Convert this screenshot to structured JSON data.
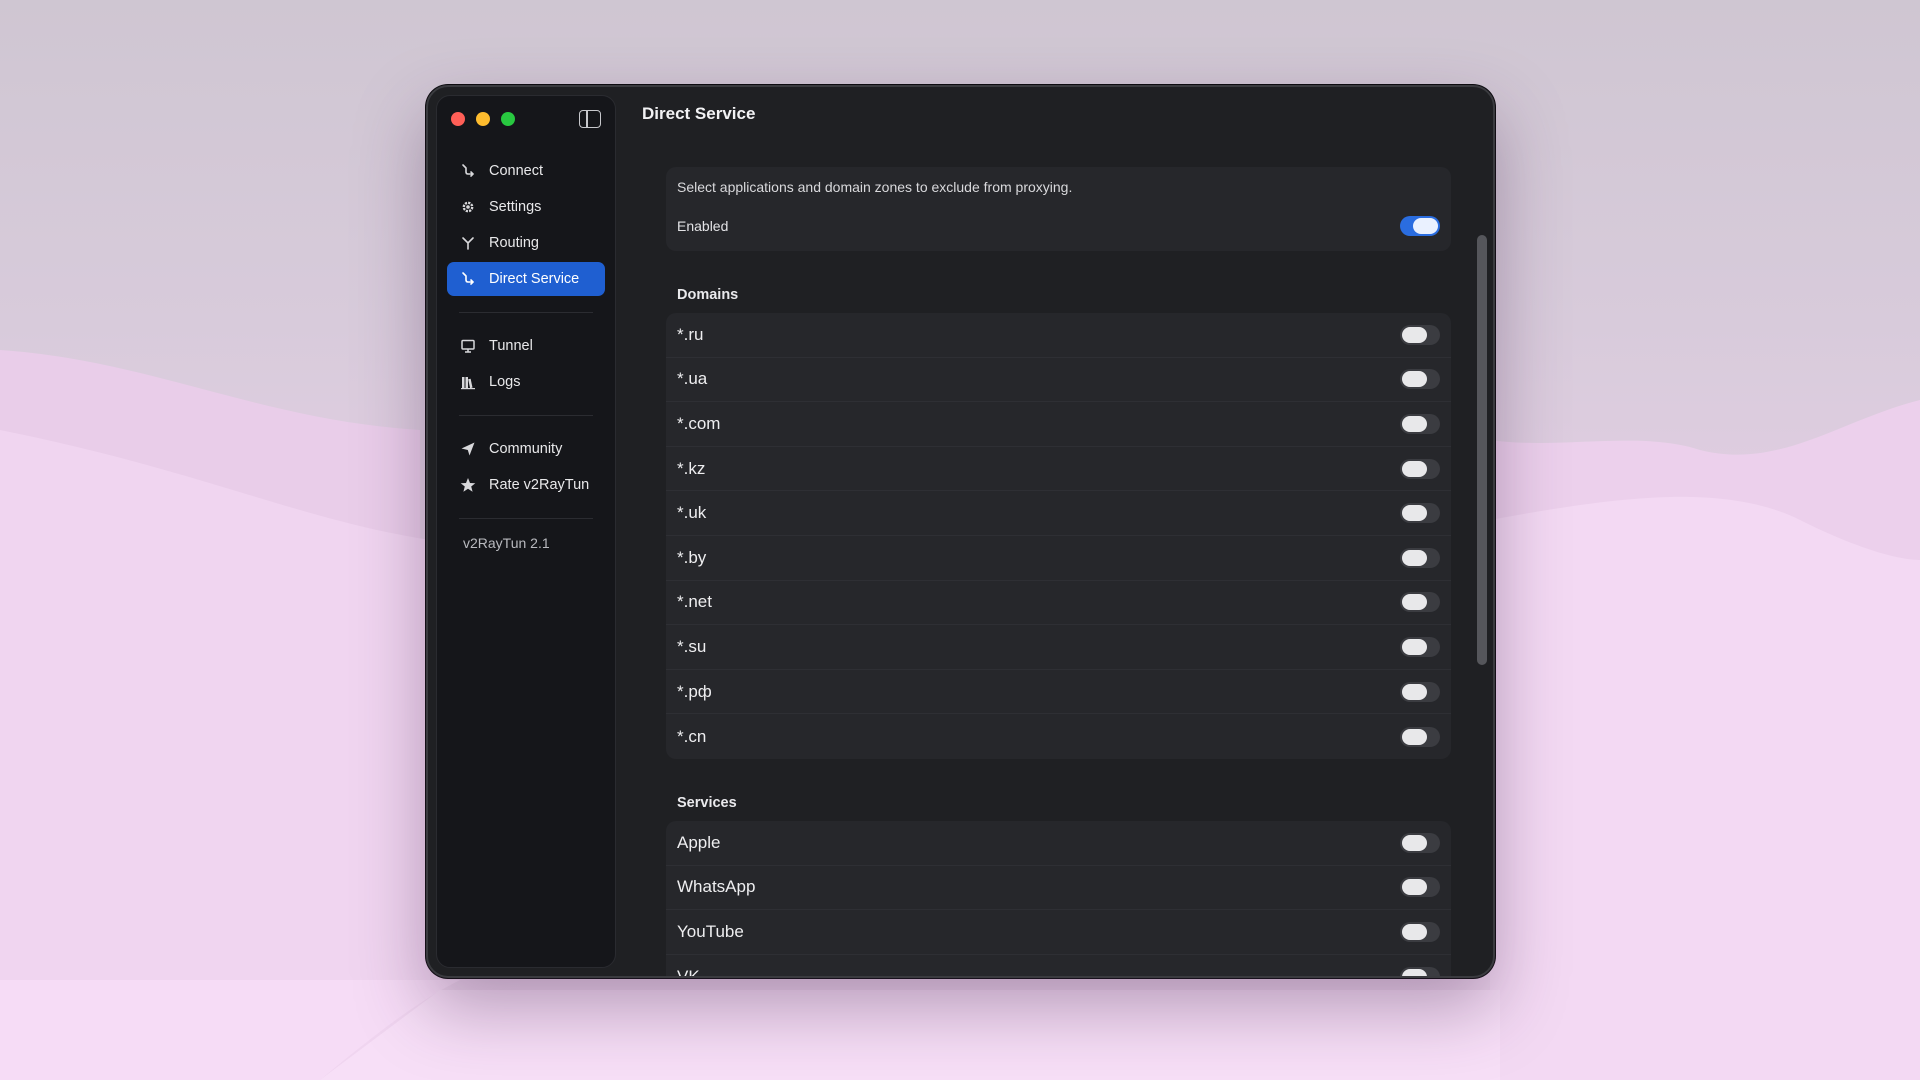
{
  "window": {
    "title": "Direct Service"
  },
  "sidebar": {
    "items": [
      {
        "label": "Connect",
        "icon": "connect-icon",
        "active": false
      },
      {
        "label": "Settings",
        "icon": "gear-icon",
        "active": false
      },
      {
        "label": "Routing",
        "icon": "routing-icon",
        "active": false
      },
      {
        "label": "Direct Service",
        "icon": "direct-service-icon",
        "active": true
      },
      {
        "label": "Tunnel",
        "icon": "monitor-icon",
        "active": false
      },
      {
        "label": "Logs",
        "icon": "logs-icon",
        "active": false
      },
      {
        "label": "Community",
        "icon": "paper-plane-icon",
        "active": false
      },
      {
        "label": "Rate v2RayTun",
        "icon": "star-icon",
        "active": false
      }
    ],
    "version": "v2RayTun 2.1"
  },
  "intro": {
    "description": "Select applications and domain zones to exclude from proxying.",
    "enabled_label": "Enabled",
    "enabled": true
  },
  "domains": {
    "title": "Domains",
    "items": [
      {
        "label": "*.ru",
        "enabled": false
      },
      {
        "label": "*.ua",
        "enabled": false
      },
      {
        "label": "*.com",
        "enabled": false
      },
      {
        "label": "*.kz",
        "enabled": false
      },
      {
        "label": "*.uk",
        "enabled": false
      },
      {
        "label": "*.by",
        "enabled": false
      },
      {
        "label": "*.net",
        "enabled": false
      },
      {
        "label": "*.su",
        "enabled": false
      },
      {
        "label": "*.рф",
        "enabled": false
      },
      {
        "label": "*.cn",
        "enabled": false
      }
    ]
  },
  "services": {
    "title": "Services",
    "items": [
      {
        "label": "Apple",
        "enabled": false
      },
      {
        "label": "WhatsApp",
        "enabled": false
      },
      {
        "label": "YouTube",
        "enabled": false
      },
      {
        "label": "VK",
        "enabled": false
      }
    ]
  },
  "colors": {
    "accent": "#1f5fd1",
    "toggle_on": "#2a6de0",
    "close": "#ff5f57",
    "minimize": "#febc2e",
    "maximize": "#28c840"
  }
}
